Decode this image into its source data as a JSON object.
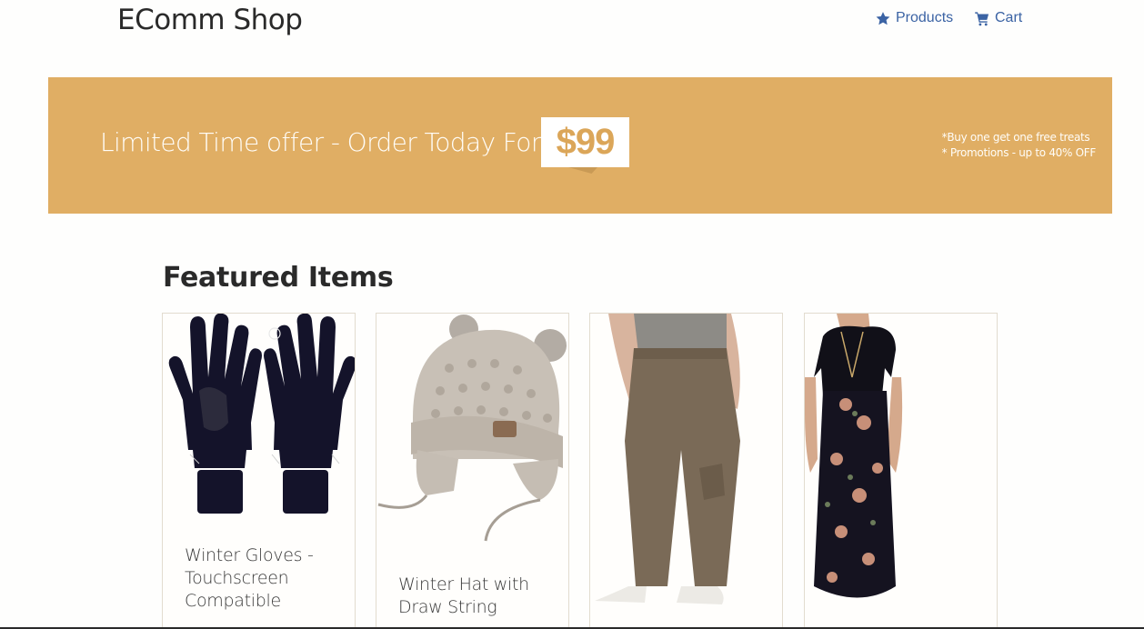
{
  "navbar": {
    "brand": "EComm Shop",
    "links": [
      {
        "label": "Products",
        "icon": "star-icon"
      },
      {
        "label": "Cart",
        "icon": "cart-icon"
      }
    ],
    "link_color": "#3b63a4"
  },
  "banner": {
    "text": "Limited Time offer - Order Today For",
    "price": "$99",
    "promos": [
      "*Buy one get one free treats",
      "* Promotions - up to 40% OFF"
    ],
    "background": "#e0ae64"
  },
  "featured": {
    "title": "Featured Items",
    "items": [
      {
        "title": "Winter Gloves - Touchscreen Compatible",
        "image": "black-gloves"
      },
      {
        "title": "Winter Hat with Draw String",
        "image": "knit-hat"
      },
      {
        "title": "",
        "image": "khaki-pants"
      },
      {
        "title": "",
        "image": "floral-maxi-dress"
      }
    ]
  }
}
